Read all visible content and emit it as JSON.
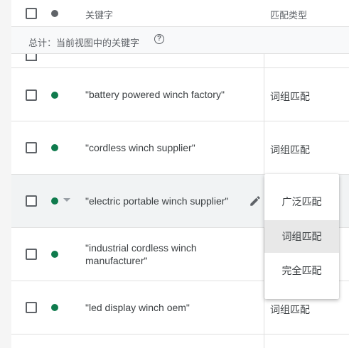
{
  "header": {
    "keyword_col": "关键字",
    "match_type_col": "匹配类型"
  },
  "summary": {
    "label": "总计：当前视图中的关键字",
    "help_icon": "help-circle-icon"
  },
  "colors": {
    "status_active": "#0f7b4d",
    "header_dot": "#5f6368"
  },
  "rows": [
    {
      "keyword": "\"battery powered winch factory\"",
      "match_type": "词组匹配"
    },
    {
      "keyword": "\"cordless winch supplier\"",
      "match_type": "词组匹配"
    },
    {
      "keyword": "\"electric portable winch supplier\"",
      "match_type": ""
    },
    {
      "keyword_line1": "\"industrial cordless winch",
      "keyword_line2": "manufacturer\"",
      "match_type": ""
    },
    {
      "keyword": "\"led display winch oem\"",
      "match_type": "词组匹配"
    }
  ],
  "dropdown": {
    "options": [
      "广泛匹配",
      "词组匹配",
      "完全匹配"
    ],
    "selected": "词组匹配"
  }
}
